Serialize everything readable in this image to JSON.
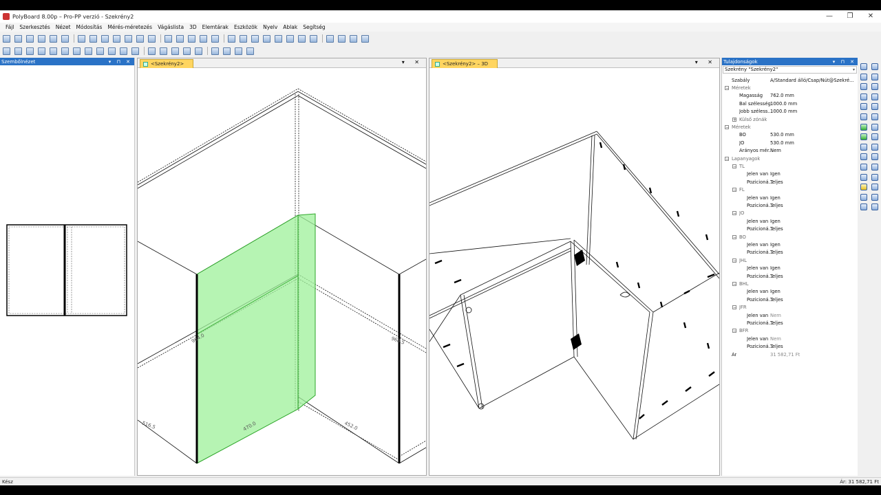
{
  "window": {
    "title": "PolyBoard 8.00p – Pro-PP verzió - Szekrény2",
    "minimize": "—",
    "maximize": "❐",
    "close": "✕"
  },
  "menu": [
    "Fájl",
    "Szerkesztés",
    "Nézet",
    "Módosítás",
    "Mérés-méretezés",
    "Vágáslista",
    "3D",
    "Elemtárak",
    "Eszközök",
    "Nyelv",
    "Ablak",
    "Segítség"
  ],
  "left_panel": {
    "title": "Szembőlnézet",
    "controls": "▾ ⊓ ✕"
  },
  "view_left": {
    "tab": "<Szekrény2>",
    "controls": "▾ ✕",
    "dims": [
      "964.0",
      "968.5",
      "516.5",
      "470.0",
      "452.0"
    ]
  },
  "view_right": {
    "tab": "<Szekrény2> – 3D",
    "controls": "▾ ✕"
  },
  "properties": {
    "title": "Tulajdonságok",
    "controls": "▾ ⊓ ✕",
    "object": "Szekrény \"Szekrény2\"",
    "rows": [
      {
        "label": "Szabály",
        "value": "A/Standard álló/Csap/Nút@Szekré...",
        "indent": 0,
        "kind": "prop"
      },
      {
        "label": "Méretek",
        "value": "",
        "indent": 0,
        "kind": "group"
      },
      {
        "label": "Magasság",
        "value": "762.0 mm",
        "indent": 1,
        "kind": "prop"
      },
      {
        "label": "Bal szélesség",
        "value": "1000.0 mm",
        "indent": 1,
        "kind": "prop"
      },
      {
        "label": "Jobb széless...",
        "value": "1000.0 mm",
        "indent": 1,
        "kind": "prop"
      },
      {
        "label": "Külső zónák",
        "value": "",
        "indent": 1,
        "kind": "subgroup"
      },
      {
        "label": "Méretek",
        "value": "",
        "indent": 0,
        "kind": "group"
      },
      {
        "label": "BO",
        "value": "530.0 mm",
        "indent": 1,
        "kind": "prop"
      },
      {
        "label": "JO",
        "value": "530.0 mm",
        "indent": 1,
        "kind": "prop"
      },
      {
        "label": "Arányos mér...",
        "value": "Nem",
        "indent": 1,
        "kind": "prop"
      },
      {
        "label": "Lapanyagok",
        "value": "",
        "indent": 0,
        "kind": "group"
      },
      {
        "label": "TL",
        "value": "",
        "indent": 1,
        "kind": "group"
      },
      {
        "label": "Jelen van",
        "value": "Igen",
        "indent": 2,
        "kind": "prop"
      },
      {
        "label": "Pozicioná...",
        "value": "Teljes",
        "indent": 2,
        "kind": "prop"
      },
      {
        "label": "FL",
        "value": "",
        "indent": 1,
        "kind": "group"
      },
      {
        "label": "Jelen van",
        "value": "Igen",
        "indent": 2,
        "kind": "prop"
      },
      {
        "label": "Pozicioná...",
        "value": "Teljes",
        "indent": 2,
        "kind": "prop"
      },
      {
        "label": "JO",
        "value": "",
        "indent": 1,
        "kind": "group"
      },
      {
        "label": "Jelen van",
        "value": "Igen",
        "indent": 2,
        "kind": "prop"
      },
      {
        "label": "Pozicioná...",
        "value": "Teljes",
        "indent": 2,
        "kind": "prop"
      },
      {
        "label": "BO",
        "value": "",
        "indent": 1,
        "kind": "group"
      },
      {
        "label": "Jelen van",
        "value": "Igen",
        "indent": 2,
        "kind": "prop"
      },
      {
        "label": "Pozicioná...",
        "value": "Teljes",
        "indent": 2,
        "kind": "prop"
      },
      {
        "label": "JHL",
        "value": "",
        "indent": 1,
        "kind": "group"
      },
      {
        "label": "Jelen van",
        "value": "Igen",
        "indent": 2,
        "kind": "prop"
      },
      {
        "label": "Pozicioná...",
        "value": "Teljes",
        "indent": 2,
        "kind": "prop"
      },
      {
        "label": "BHL",
        "value": "",
        "indent": 1,
        "kind": "group"
      },
      {
        "label": "Jelen van",
        "value": "Igen",
        "indent": 2,
        "kind": "prop"
      },
      {
        "label": "Pozicioná...",
        "value": "Teljes",
        "indent": 2,
        "kind": "prop"
      },
      {
        "label": "JFR",
        "value": "",
        "indent": 1,
        "kind": "group"
      },
      {
        "label": "Jelen van",
        "value": "Nem",
        "indent": 2,
        "kind": "prop-dim"
      },
      {
        "label": "Pozicioná...",
        "value": "Teljes",
        "indent": 2,
        "kind": "prop"
      },
      {
        "label": "BFR",
        "value": "",
        "indent": 1,
        "kind": "group"
      },
      {
        "label": "Jelen van",
        "value": "Nem",
        "indent": 2,
        "kind": "prop-dim"
      },
      {
        "label": "Pozicioná...",
        "value": "Teljes",
        "indent": 2,
        "kind": "prop"
      },
      {
        "label": "Ár",
        "value": "31 582,71 Ft",
        "indent": 0,
        "kind": "prop-dim"
      }
    ]
  },
  "status": {
    "left": "Kész",
    "right": "Ár: 31 582,71 Ft"
  },
  "colors": {
    "highlight_panel": "#9ef09a",
    "tab": "#ffd560",
    "panel_header": "#2a72c6"
  }
}
